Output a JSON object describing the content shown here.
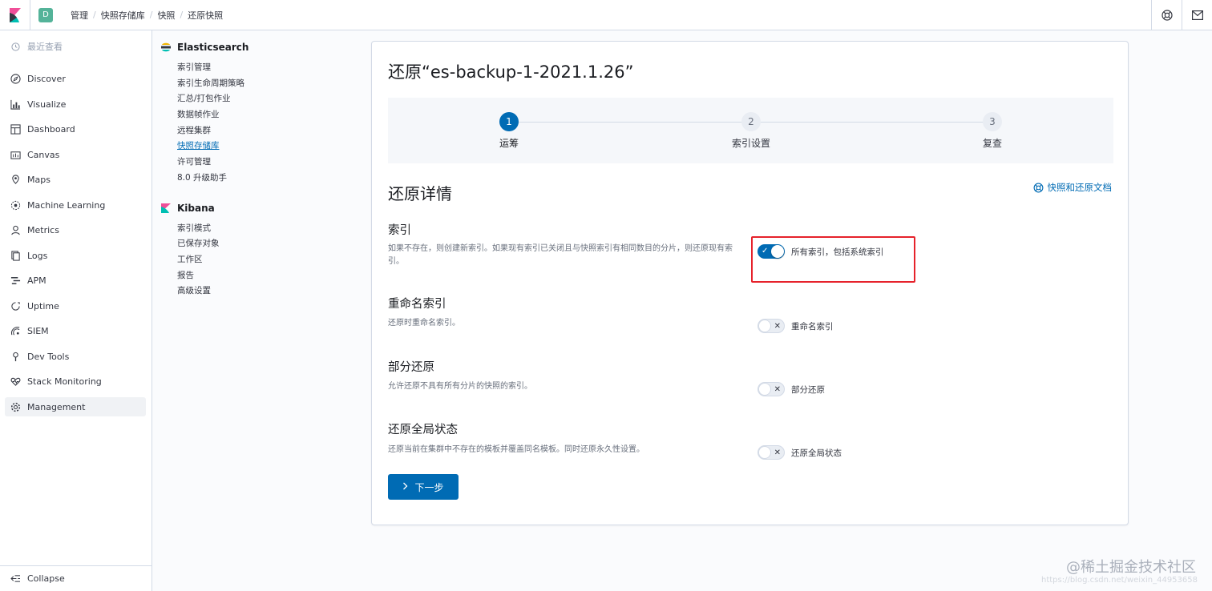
{
  "header": {
    "space_initial": "D",
    "breadcrumbs": [
      "管理",
      "快照存储库",
      "快照",
      "还原快照"
    ]
  },
  "nav": {
    "recent_label": "最近查看",
    "items": [
      "Discover",
      "Visualize",
      "Dashboard",
      "Canvas",
      "Maps",
      "Machine Learning",
      "Metrics",
      "Logs",
      "APM",
      "Uptime",
      "SIEM",
      "Dev Tools",
      "Stack Monitoring",
      "Management"
    ],
    "active": "Management",
    "collapse_label": "Collapse"
  },
  "mgmt": {
    "elasticsearch_label": "Elasticsearch",
    "es_links": [
      "索引管理",
      "索引生命周期策略",
      "汇总/打包作业",
      "数据帧作业",
      "远程集群",
      "快照存储库",
      "许可管理",
      "8.0 升级助手"
    ],
    "es_active": "快照存储库",
    "kibana_label": "Kibana",
    "kibana_links": [
      "索引模式",
      "已保存对象",
      "工作区",
      "报告",
      "高级设置"
    ]
  },
  "panel": {
    "title": "还原“es-backup-1-2021.1.26”",
    "steps": [
      {
        "num": "1",
        "label": "运筹"
      },
      {
        "num": "2",
        "label": "索引设置"
      },
      {
        "num": "3",
        "label": "复查"
      }
    ],
    "current_step": 1,
    "section_title": "还原详情",
    "doc_link": "快照和还原文档",
    "rows": [
      {
        "title": "索引",
        "desc": "如果不存在，则创建新索引。如果现有索引已关闭且与快照索引有相同数目的分片，则还原现有索引。",
        "switch_label": "所有索引，包括系统索引",
        "on": true
      },
      {
        "title": "重命名索引",
        "desc": "还原时重命名索引。",
        "switch_label": "重命名索引",
        "on": false
      },
      {
        "title": "部分还原",
        "desc": "允许还原不具有所有分片的快照的索引。",
        "switch_label": "部分还原",
        "on": false
      },
      {
        "title": "还原全局状态",
        "desc": "还原当前在集群中不存在的模板并覆盖同名模板。同时还原永久性设置。",
        "switch_label": "还原全局状态",
        "on": false
      }
    ],
    "next_label": "下一步"
  },
  "watermark": {
    "text": "@稀土掘金技术社区",
    "sub": "https://blog.csdn.net/weixin_44953658"
  },
  "colors": {
    "accent": "#006bb4",
    "highlight": "#e6222b"
  }
}
